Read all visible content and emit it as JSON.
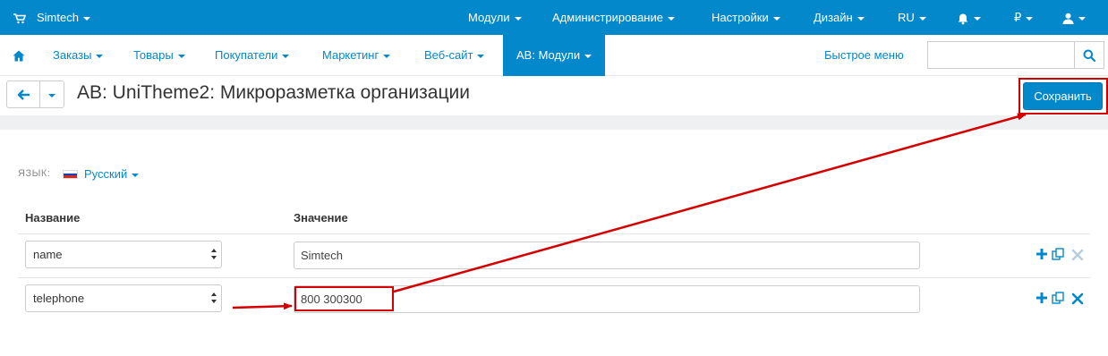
{
  "topbar": {
    "store_name": "Simtech",
    "menu": [
      "Модули",
      "Администрирование",
      "Настройки",
      "Дизайн",
      "RU"
    ],
    "currency": "₽"
  },
  "navbar": {
    "items": [
      "Заказы",
      "Товары",
      "Покупатели",
      "Маркетинг",
      "Веб-сайт",
      "AB: Модули"
    ],
    "quick_menu": "Быстрое меню",
    "search_placeholder": ""
  },
  "page": {
    "title": "AB: UniTheme2: Микроразметка организации",
    "save_label": "Сохранить"
  },
  "language": {
    "label": "ЯЗЫК:",
    "value": "Русский"
  },
  "table": {
    "headers": {
      "name": "Название",
      "value": "Значение"
    },
    "rows": [
      {
        "name": "name",
        "value": "Simtech"
      },
      {
        "name": "telephone",
        "value": "800 300300"
      }
    ]
  },
  "colors": {
    "accent": "#0388cc",
    "annotation": "#d40000"
  }
}
